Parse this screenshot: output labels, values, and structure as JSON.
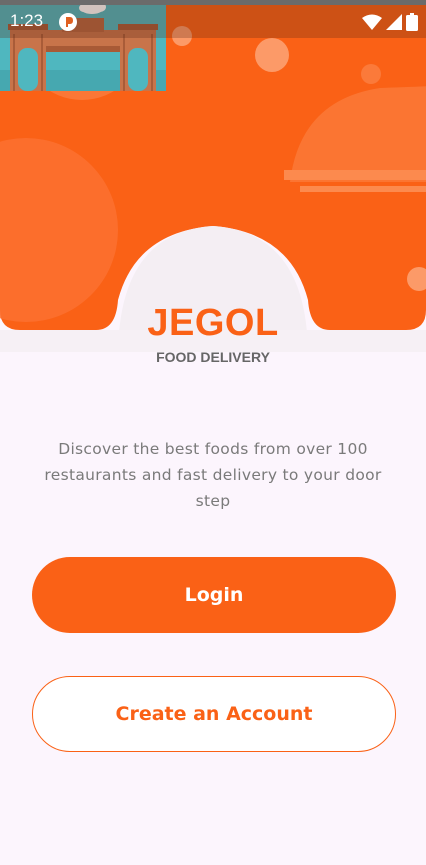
{
  "status_bar": {
    "time": "1:23",
    "app_icon": "notification-app-icon",
    "icons": [
      "wifi-icon",
      "signal-icon",
      "battery-icon"
    ]
  },
  "hero": {
    "logo": "city-gate-logo-image"
  },
  "brand": {
    "name": "JEGOL",
    "subtitle": "FOOD DELIVERY"
  },
  "tagline": "Discover the best foods from over 100 restaurants and fast delivery to your door step",
  "buttons": {
    "login": "Login",
    "create_account": "Create an Account"
  },
  "colors": {
    "accent": "#fa6116",
    "background": "#fcf5fd",
    "muted_text": "#7a7a7a"
  }
}
